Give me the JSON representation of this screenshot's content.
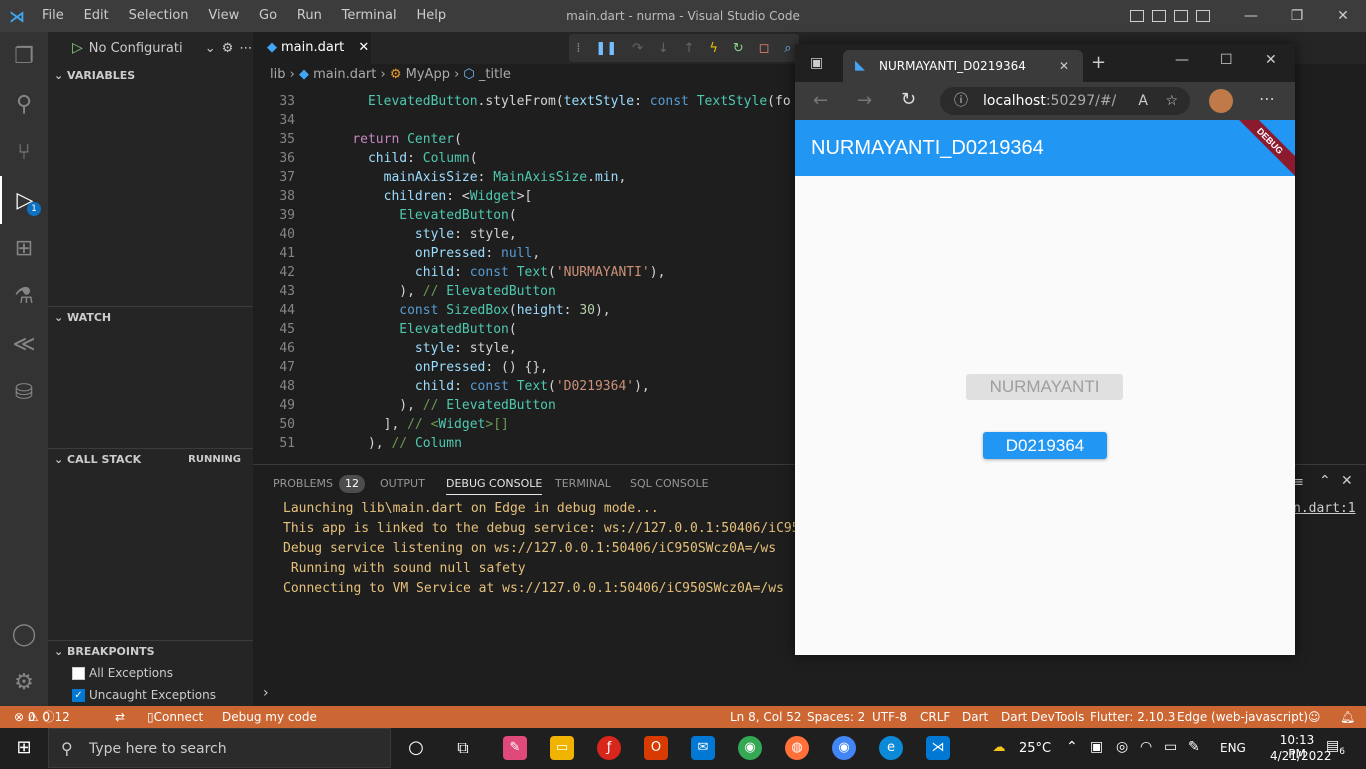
{
  "window": {
    "title": "main.dart - nurma - Visual Studio Code",
    "menu": [
      "File",
      "Edit",
      "Selection",
      "View",
      "Go",
      "Run",
      "Terminal",
      "Help"
    ]
  },
  "activity_bar": {
    "icons": [
      "explorer-icon",
      "search-icon",
      "source-control-icon",
      "run-debug-icon",
      "extensions-icon",
      "testing-icon",
      "flutter-icon",
      "database-icon",
      "account-icon",
      "settings-gear-icon"
    ],
    "debug_badge": "1"
  },
  "sidebar": {
    "config_label": "No Configurati",
    "sections": {
      "variables": "VARIABLES",
      "watch": "WATCH",
      "call_stack": "CALL STACK",
      "call_stack_status": "RUNNING",
      "breakpoints": "BREAKPOINTS"
    },
    "breakpoints": [
      {
        "label": "All Exceptions",
        "checked": false
      },
      {
        "label": "Uncaught Exceptions",
        "checked": true
      }
    ]
  },
  "editor": {
    "tab": "main.dart",
    "breadcrumb": [
      "lib",
      "main.dart",
      "MyApp",
      "_title"
    ],
    "lines": [
      {
        "n": "33",
        "text": "      ElevatedButton.styleFrom(textStyle: const TextStyle(fo"
      },
      {
        "n": "34",
        "text": ""
      },
      {
        "n": "35",
        "text": "    return Center("
      },
      {
        "n": "36",
        "text": "      child: Column("
      },
      {
        "n": "37",
        "text": "        mainAxisSize: MainAxisSize.min,"
      },
      {
        "n": "38",
        "text": "        children: <Widget>["
      },
      {
        "n": "39",
        "text": "          ElevatedButton("
      },
      {
        "n": "40",
        "text": "            style: style,"
      },
      {
        "n": "41",
        "text": "            onPressed: null,"
      },
      {
        "n": "42",
        "text": "            child: const Text('NURMAYANTI'),"
      },
      {
        "n": "43",
        "text": "          ), // ElevatedButton"
      },
      {
        "n": "44",
        "text": "          const SizedBox(height: 30),"
      },
      {
        "n": "45",
        "text": "          ElevatedButton("
      },
      {
        "n": "46",
        "text": "            style: style,"
      },
      {
        "n": "47",
        "text": "            onPressed: () {},"
      },
      {
        "n": "48",
        "text": "            child: const Text('D0219364'),"
      },
      {
        "n": "49",
        "text": "          ), // ElevatedButton"
      },
      {
        "n": "50",
        "text": "        ], // <Widget>[]"
      },
      {
        "n": "51",
        "text": "      ), // Column"
      }
    ]
  },
  "panel": {
    "tabs": [
      "PROBLEMS",
      "OUTPUT",
      "DEBUG CONSOLE",
      "TERMINAL",
      "SQL CONSOLE"
    ],
    "problems_count": "12",
    "active_tab": "DEBUG CONSOLE",
    "console": [
      "Launching lib\\main.dart on Edge in debug mode...",
      "This app is linked to the debug service: ws://127.0.0.1:50406/iC950",
      "Debug service listening on ws://127.0.0.1:50406/iC950SWcz0A=/ws",
      " Running with sound null safety",
      "Connecting to VM Service at ws://127.0.0.1:50406/iC950SWcz0A=/ws"
    ],
    "right_link": "n.dart:1"
  },
  "status_bar": {
    "errors": "0",
    "warnings": "0",
    "infos": "12",
    "connect": "Connect",
    "debug_label": "Debug my code",
    "position": "Ln 8, Col 52",
    "spaces": "Spaces: 2",
    "encoding": "UTF-8",
    "eol": "CRLF",
    "language": "Dart",
    "devtools": "Dart DevTools",
    "flutter": "Flutter: 2.10.3",
    "device": "Edge (web-javascript)"
  },
  "browser": {
    "tab_title": "NURMAYANTI_D0219364",
    "url_host": "localhost",
    "url_rest": ":50297/#/",
    "app_title": "NURMAYANTI_D0219364",
    "debug_ribbon": "DEBUG",
    "button_disabled": "NURMAYANTI",
    "button_enabled": "D0219364"
  },
  "taskbar": {
    "search_placeholder": "Type here to search",
    "weather": "25°C",
    "language": "ENG",
    "time": "10:13 PM",
    "date": "4/21/2022",
    "notifications": "6"
  }
}
